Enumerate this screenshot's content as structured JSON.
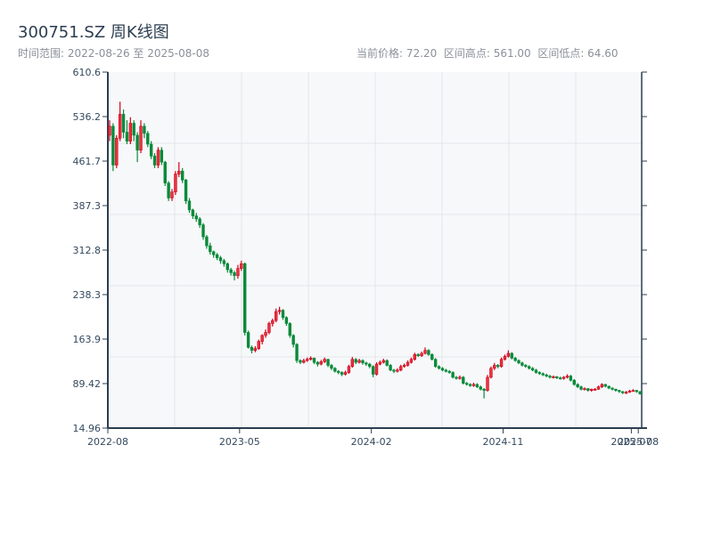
{
  "header": {
    "title": "300751.SZ 周K线图",
    "range_text": "时间范围: 2022-08-26 至 2025-08-08",
    "stats_text": "当前价格: 72.20  区间高点: 561.00  区间低点: 64.60"
  },
  "colors": {
    "up": "#d0021b",
    "up_fill": "#e8333f",
    "down": "#0a8a3a",
    "plot_bg": "#f7f8fa",
    "grid": "#e3e6ea",
    "axis": "#2c3e50"
  },
  "chart_data": {
    "type": "candlestick",
    "title": "300751.SZ 周K线图",
    "start_date": "2022-08-26",
    "end_date": "2025-08-08",
    "ylim": [
      14.96,
      610.6
    ],
    "yticks": [
      "610.6",
      "536.2",
      "461.7",
      "387.3",
      "312.8",
      "238.3",
      "163.9",
      "89.42",
      "14.96"
    ],
    "xticks": [
      {
        "label": "2022-08",
        "week": 0
      },
      {
        "label": "2023-05",
        "week": 38
      },
      {
        "label": "2024-02",
        "week": 76
      },
      {
        "label": "2024-11",
        "week": 114
      },
      {
        "label": "2025-07",
        "week": 151
      },
      {
        "label": "2025-08",
        "week": 153
      }
    ],
    "grid": true,
    "ohlc": [
      [
        505,
        530,
        495,
        520
      ],
      [
        520,
        525,
        445,
        455
      ],
      [
        455,
        505,
        450,
        500
      ],
      [
        500,
        561,
        495,
        540
      ],
      [
        540,
        548,
        500,
        510
      ],
      [
        510,
        530,
        490,
        495
      ],
      [
        495,
        535,
        490,
        525
      ],
      [
        525,
        530,
        495,
        505
      ],
      [
        505,
        510,
        460,
        480
      ],
      [
        480,
        530,
        475,
        520
      ],
      [
        520,
        525,
        500,
        508
      ],
      [
        508,
        512,
        485,
        490
      ],
      [
        490,
        495,
        465,
        470
      ],
      [
        470,
        475,
        450,
        455
      ],
      [
        455,
        485,
        450,
        480
      ],
      [
        480,
        485,
        455,
        460
      ],
      [
        460,
        462,
        420,
        425
      ],
      [
        425,
        428,
        395,
        400
      ],
      [
        400,
        415,
        395,
        410
      ],
      [
        410,
        445,
        405,
        440
      ],
      [
        440,
        460,
        435,
        445
      ],
      [
        445,
        450,
        425,
        430
      ],
      [
        430,
        432,
        390,
        395
      ],
      [
        395,
        400,
        375,
        380
      ],
      [
        380,
        382,
        365,
        370
      ],
      [
        370,
        375,
        360,
        365
      ],
      [
        365,
        368,
        350,
        355
      ],
      [
        355,
        358,
        330,
        335
      ],
      [
        335,
        338,
        315,
        320
      ],
      [
        320,
        325,
        305,
        310
      ],
      [
        310,
        312,
        300,
        305
      ],
      [
        305,
        308,
        296,
        300
      ],
      [
        300,
        303,
        290,
        295
      ],
      [
        295,
        298,
        285,
        290
      ],
      [
        290,
        292,
        275,
        280
      ],
      [
        280,
        283,
        270,
        275
      ],
      [
        275,
        278,
        262,
        270
      ],
      [
        270,
        288,
        265,
        282
      ],
      [
        282,
        295,
        278,
        290
      ],
      [
        290,
        292,
        170,
        175
      ],
      [
        175,
        178,
        148,
        150
      ],
      [
        150,
        153,
        140,
        145
      ],
      [
        145,
        152,
        142,
        148
      ],
      [
        148,
        163,
        146,
        160
      ],
      [
        160,
        172,
        155,
        170
      ],
      [
        170,
        180,
        166,
        175
      ],
      [
        175,
        193,
        172,
        190
      ],
      [
        190,
        198,
        185,
        195
      ],
      [
        195,
        215,
        192,
        210
      ],
      [
        210,
        218,
        205,
        212
      ],
      [
        212,
        214,
        196,
        200
      ],
      [
        200,
        202,
        186,
        190
      ],
      [
        190,
        192,
        166,
        170
      ],
      [
        170,
        172,
        150,
        155
      ],
      [
        155,
        157,
        124,
        128
      ],
      [
        128,
        130,
        122,
        125
      ],
      [
        125,
        131,
        123,
        128
      ],
      [
        128,
        133,
        126,
        130
      ],
      [
        130,
        135,
        128,
        132
      ],
      [
        132,
        133,
        122,
        125
      ],
      [
        125,
        127,
        118,
        122
      ],
      [
        122,
        129,
        120,
        126
      ],
      [
        126,
        133,
        124,
        130
      ],
      [
        130,
        131,
        117,
        120
      ],
      [
        120,
        122,
        112,
        115
      ],
      [
        115,
        117,
        108,
        110
      ],
      [
        110,
        112,
        105,
        108
      ],
      [
        108,
        110,
        102,
        105
      ],
      [
        105,
        111,
        103,
        108
      ],
      [
        108,
        121,
        106,
        118
      ],
      [
        118,
        134,
        116,
        130
      ],
      [
        130,
        132,
        122,
        125
      ],
      [
        125,
        131,
        123,
        128
      ],
      [
        128,
        130,
        121,
        124
      ],
      [
        124,
        126,
        119,
        122
      ],
      [
        122,
        124,
        115,
        118
      ],
      [
        118,
        120,
        100,
        105
      ],
      [
        105,
        125,
        103,
        122
      ],
      [
        122,
        128,
        120,
        125
      ],
      [
        125,
        131,
        123,
        128
      ],
      [
        128,
        130,
        118,
        120
      ],
      [
        120,
        122,
        110,
        112
      ],
      [
        112,
        114,
        107,
        110
      ],
      [
        110,
        115,
        108,
        112
      ],
      [
        112,
        121,
        110,
        118
      ],
      [
        118,
        123,
        116,
        120
      ],
      [
        120,
        128,
        118,
        125
      ],
      [
        125,
        133,
        123,
        130
      ],
      [
        130,
        141,
        128,
        138
      ],
      [
        138,
        140,
        134,
        136
      ],
      [
        136,
        143,
        134,
        140
      ],
      [
        140,
        150,
        138,
        145
      ],
      [
        145,
        147,
        136,
        138
      ],
      [
        138,
        140,
        128,
        130
      ],
      [
        130,
        132,
        116,
        118
      ],
      [
        118,
        120,
        113,
        115
      ],
      [
        115,
        117,
        110,
        112
      ],
      [
        112,
        114,
        108,
        110
      ],
      [
        110,
        112,
        106,
        108
      ],
      [
        108,
        110,
        98,
        100
      ],
      [
        100,
        102,
        96,
        98
      ],
      [
        98,
        103,
        96,
        100
      ],
      [
        100,
        102,
        88,
        90
      ],
      [
        90,
        92,
        86,
        88
      ],
      [
        88,
        90,
        84,
        86
      ],
      [
        86,
        91,
        84,
        88
      ],
      [
        88,
        90,
        82,
        84
      ],
      [
        84,
        86,
        78,
        80
      ],
      [
        80,
        82,
        64.6,
        78
      ],
      [
        78,
        104,
        76,
        100
      ],
      [
        100,
        118,
        98,
        115
      ],
      [
        115,
        124,
        112,
        120
      ],
      [
        120,
        122,
        115,
        118
      ],
      [
        118,
        133,
        116,
        130
      ],
      [
        130,
        138,
        128,
        135
      ],
      [
        135,
        145,
        133,
        140
      ],
      [
        140,
        142,
        130,
        132
      ],
      [
        132,
        134,
        126,
        128
      ],
      [
        128,
        130,
        122,
        124
      ],
      [
        124,
        126,
        118,
        120
      ],
      [
        120,
        122,
        116,
        118
      ],
      [
        118,
        120,
        113,
        115
      ],
      [
        115,
        117,
        110,
        112
      ],
      [
        112,
        114,
        106,
        108
      ],
      [
        108,
        110,
        104,
        106
      ],
      [
        106,
        108,
        102,
        104
      ],
      [
        104,
        106,
        100,
        102
      ],
      [
        102,
        104,
        98,
        100
      ],
      [
        100,
        103,
        98,
        101
      ],
      [
        101,
        102,
        97,
        99
      ],
      [
        99,
        101,
        96,
        98
      ],
      [
        98,
        102,
        96,
        100
      ],
      [
        100,
        105,
        98,
        102
      ],
      [
        102,
        104,
        93,
        95
      ],
      [
        95,
        97,
        86,
        88
      ],
      [
        88,
        90,
        82,
        84
      ],
      [
        84,
        86,
        78,
        80
      ],
      [
        80,
        83,
        78,
        81
      ],
      [
        81,
        82,
        76,
        78
      ],
      [
        78,
        81,
        76,
        80
      ],
      [
        79,
        82,
        78,
        80
      ],
      [
        80,
        86,
        79,
        84
      ],
      [
        84,
        90,
        82,
        88
      ],
      [
        88,
        89,
        83,
        85
      ],
      [
        85,
        86,
        80,
        82
      ],
      [
        82,
        83,
        78,
        80
      ],
      [
        80,
        81,
        76,
        78
      ],
      [
        78,
        79,
        74,
        76
      ],
      [
        76,
        77,
        72,
        74
      ],
      [
        74,
        77,
        72,
        75
      ],
      [
        75,
        79,
        74,
        77
      ],
      [
        77,
        80,
        76,
        78
      ],
      [
        78,
        79,
        74,
        76
      ],
      [
        76,
        77,
        71,
        72.2
      ]
    ]
  }
}
